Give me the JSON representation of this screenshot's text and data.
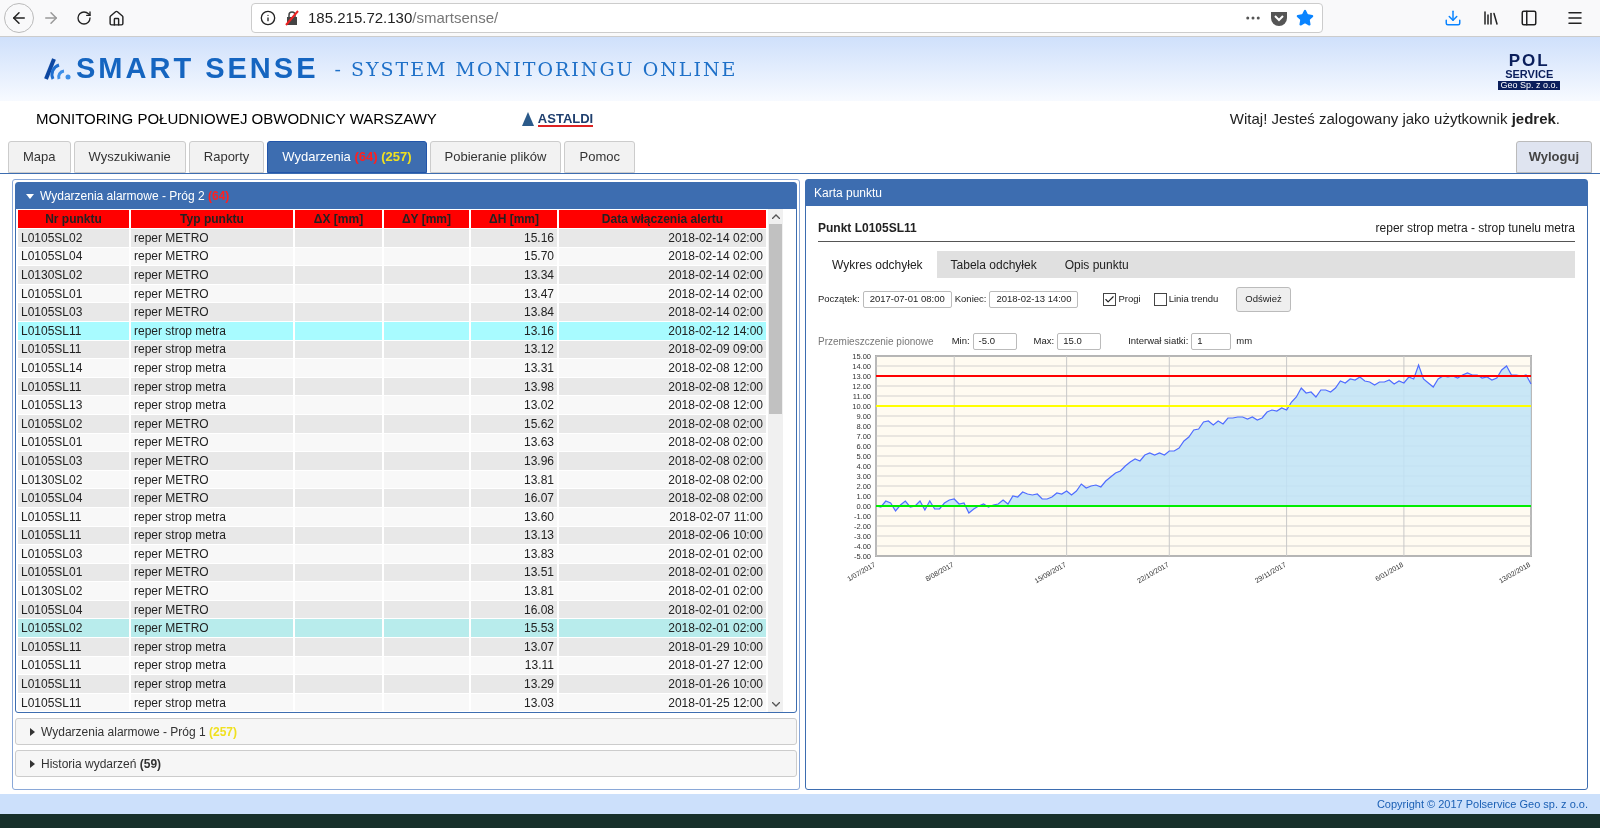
{
  "browser": {
    "url_host": "185.215.72.130",
    "url_path": "/smartsense/"
  },
  "header": {
    "brand": "SMART SENSE",
    "tagline": "- SYSTEM MONITORINGU ONLINE",
    "partner_top": "POL",
    "partner_middle": "SERVICE",
    "partner_bottom": "Geo Sp. z o.o.",
    "project": "MONITORING POŁUDNIOWEJ OBWODNICY WARSZAWY",
    "contractor": "ASTALDI",
    "welcome": "Witaj! Jesteś zalogowany jako użytkownik **jedrek**."
  },
  "tabs": [
    {
      "label": "Mapa",
      "selected": false
    },
    {
      "label": "Wyszukiwanie",
      "selected": false
    },
    {
      "label": "Raporty",
      "selected": false
    },
    {
      "label": "Wydarzenia",
      "alarm_count": "(64)",
      "warning_count": "(257)",
      "selected": true
    },
    {
      "label": "Pobieranie plików",
      "selected": false
    },
    {
      "label": "Pomoc",
      "selected": false
    }
  ],
  "logout": "Wyloguj",
  "events_panel": {
    "sections": [
      {
        "title": "Wydarzenia alarmowe - Próg 2",
        "count": "(64)",
        "color": "#ff2020",
        "expanded": true
      },
      {
        "title": "Wydarzenia alarmowe - Próg 1",
        "count": "(257)",
        "color": "#f0e020",
        "expanded": false
      },
      {
        "title": "Historia wydarzeń",
        "count": "(59)",
        "color": "#333333",
        "expanded": false
      }
    ],
    "table": {
      "columns": [
        "Nr punktu",
        "Typ punktu",
        "ΔX [mm]",
        "ΔY [mm]",
        "ΔH [mm]",
        "Data włączenia alertu"
      ],
      "rows": [
        {
          "point": "L0105SL02",
          "type": "reper METRO",
          "dh": "15.16",
          "date": "2018-02-14 02:00",
          "selected": false,
          "hovered": false
        },
        {
          "point": "L0105SL04",
          "type": "reper METRO",
          "dh": "15.70",
          "date": "2018-02-14 02:00",
          "selected": false,
          "hovered": false
        },
        {
          "point": "L0130SL02",
          "type": "reper METRO",
          "dh": "13.34",
          "date": "2018-02-14 02:00",
          "selected": false,
          "hovered": false
        },
        {
          "point": "L0105SL01",
          "type": "reper METRO",
          "dh": "13.47",
          "date": "2018-02-14 02:00",
          "selected": false,
          "hovered": false
        },
        {
          "point": "L0105SL03",
          "type": "reper METRO",
          "dh": "13.84",
          "date": "2018-02-14 02:00",
          "selected": false,
          "hovered": false
        },
        {
          "point": "L0105SL11",
          "type": "reper strop metra",
          "dh": "13.16",
          "date": "2018-02-12 14:00",
          "selected": true,
          "hovered": false
        },
        {
          "point": "L0105SL11",
          "type": "reper strop metra",
          "dh": "13.12",
          "date": "2018-02-09 09:00",
          "selected": false,
          "hovered": false
        },
        {
          "point": "L0105SL14",
          "type": "reper strop metra",
          "dh": "13.31",
          "date": "2018-02-08 12:00",
          "selected": false,
          "hovered": false
        },
        {
          "point": "L0105SL11",
          "type": "reper strop metra",
          "dh": "13.98",
          "date": "2018-02-08 12:00",
          "selected": false,
          "hovered": false
        },
        {
          "point": "L0105SL13",
          "type": "reper strop metra",
          "dh": "13.02",
          "date": "2018-02-08 12:00",
          "selected": false,
          "hovered": false
        },
        {
          "point": "L0105SL02",
          "type": "reper METRO",
          "dh": "15.62",
          "date": "2018-02-08 02:00",
          "selected": false,
          "hovered": false
        },
        {
          "point": "L0105SL01",
          "type": "reper METRO",
          "dh": "13.63",
          "date": "2018-02-08 02:00",
          "selected": false,
          "hovered": false
        },
        {
          "point": "L0105SL03",
          "type": "reper METRO",
          "dh": "13.96",
          "date": "2018-02-08 02:00",
          "selected": false,
          "hovered": false
        },
        {
          "point": "L0130SL02",
          "type": "reper METRO",
          "dh": "13.81",
          "date": "2018-02-08 02:00",
          "selected": false,
          "hovered": false
        },
        {
          "point": "L0105SL04",
          "type": "reper METRO",
          "dh": "16.07",
          "date": "2018-02-08 02:00",
          "selected": false,
          "hovered": false
        },
        {
          "point": "L0105SL11",
          "type": "reper strop metra",
          "dh": "13.60",
          "date": "2018-02-07 11:00",
          "selected": false,
          "hovered": false
        },
        {
          "point": "L0105SL11",
          "type": "reper strop metra",
          "dh": "13.13",
          "date": "2018-02-06 10:00",
          "selected": false,
          "hovered": false
        },
        {
          "point": "L0105SL03",
          "type": "reper METRO",
          "dh": "13.83",
          "date": "2018-02-01 02:00",
          "selected": false,
          "hovered": false
        },
        {
          "point": "L0105SL01",
          "type": "reper METRO",
          "dh": "13.51",
          "date": "2018-02-01 02:00",
          "selected": false,
          "hovered": false
        },
        {
          "point": "L0130SL02",
          "type": "reper METRO",
          "dh": "13.81",
          "date": "2018-02-01 02:00",
          "selected": false,
          "hovered": false
        },
        {
          "point": "L0105SL04",
          "type": "reper METRO",
          "dh": "16.08",
          "date": "2018-02-01 02:00",
          "selected": false,
          "hovered": false
        },
        {
          "point": "L0105SL02",
          "type": "reper METRO",
          "dh": "15.53",
          "date": "2018-02-01 02:00",
          "selected": false,
          "hovered": true
        },
        {
          "point": "L0105SL11",
          "type": "reper strop metra",
          "dh": "13.07",
          "date": "2018-01-29 10:00",
          "selected": false,
          "hovered": false
        },
        {
          "point": "L0105SL11",
          "type": "reper strop metra",
          "dh": "13.11",
          "date": "2018-01-27 12:00",
          "selected": false,
          "hovered": false
        },
        {
          "point": "L0105SL11",
          "type": "reper strop metra",
          "dh": "13.29",
          "date": "2018-01-26 10:00",
          "selected": false,
          "hovered": false
        },
        {
          "point": "L0105SL11",
          "type": "reper strop metra",
          "dh": "13.03",
          "date": "2018-01-25 12:00",
          "selected": false,
          "hovered": false
        }
      ]
    }
  },
  "point_card": {
    "title": "Karta punktu",
    "point": "Punkt L0105SL11",
    "description": "reper strop metra - strop tunelu metra",
    "tabs": [
      {
        "label": "Wykres odchyłek",
        "selected": true
      },
      {
        "label": "Tabela odchyłek",
        "selected": false
      },
      {
        "label": "Opis punktu",
        "selected": false
      }
    ],
    "start_label": "Początek:",
    "start": "2017-07-01 08:00",
    "end_label": "Koniec:",
    "end": "2018-02-13 14:00",
    "options": [
      {
        "label": "Progi",
        "checked": true
      },
      {
        "label": "Linia trendu",
        "checked": false
      }
    ],
    "refresh": "Odśwież",
    "chart_title": "Przemieszczenie pionowe",
    "min_label": "Min:",
    "min": "-5.0",
    "max_label": "Max:",
    "max": "15.0",
    "grid_label": "Interwał siatki:",
    "grid": "1",
    "grid_unit": "mm",
    "chart_data": {
      "type": "area",
      "grid": true,
      "ylim": [
        -5,
        15
      ],
      "categories": [
        "1/07/2017",
        null,
        null,
        null,
        null,
        null,
        null,
        null,
        null,
        null,
        null,
        null,
        null,
        null,
        null,
        null,
        "8/08/2017",
        null,
        null,
        null,
        null,
        null,
        null,
        null,
        null,
        null,
        null,
        null,
        null,
        null,
        null,
        null,
        null,
        null,
        null,
        null,
        null,
        null,
        null,
        "15/09/2017",
        null,
        null,
        null,
        null,
        null,
        null,
        null,
        null,
        null,
        null,
        null,
        null,
        null,
        null,
        null,
        null,
        null,
        null,
        null,
        null,
        "22/10/2017",
        null,
        null,
        null,
        null,
        null,
        null,
        null,
        null,
        null,
        null,
        null,
        null,
        null,
        null,
        null,
        null,
        null,
        null,
        null,
        null,
        null,
        null,
        null,
        "29/11/2017",
        null,
        null,
        null,
        null,
        null,
        null,
        null,
        null,
        null,
        null,
        null,
        null,
        null,
        null,
        null,
        null,
        null,
        null,
        null,
        null,
        null,
        null,
        null,
        "6/01/2018",
        null,
        null,
        null,
        null,
        null,
        null,
        null,
        null,
        null,
        null,
        null,
        null,
        null,
        null,
        null,
        null,
        null,
        null,
        null,
        null,
        null,
        null,
        null,
        null,
        null,
        "13/02/2018"
      ],
      "yticks": [
        {
          "value": -5,
          "label": "-5.00"
        },
        {
          "value": -4,
          "label": "-4.00"
        },
        {
          "value": -3,
          "label": "-3.00"
        },
        {
          "value": -2,
          "label": "-2.00"
        },
        {
          "value": -1,
          "label": "-1.00"
        },
        {
          "value": 0,
          "label": "0.00"
        },
        {
          "value": 1,
          "label": "1.00"
        },
        {
          "value": 2,
          "label": "2.00"
        },
        {
          "value": 3,
          "label": "3.00"
        },
        {
          "value": 4,
          "label": "4.00"
        },
        {
          "value": 5,
          "label": "5.00"
        },
        {
          "value": 6,
          "label": "6.00"
        },
        {
          "value": 7,
          "label": "7.00"
        },
        {
          "value": 8,
          "label": "8.00"
        },
        {
          "value": 9,
          "label": "9.00"
        },
        {
          "value": 10,
          "label": "10.00"
        },
        {
          "value": 11,
          "label": "11.00"
        },
        {
          "value": 12,
          "label": "12.00"
        },
        {
          "value": 13,
          "label": "13.00"
        },
        {
          "value": 14,
          "label": "14.00"
        },
        {
          "value": 15,
          "label": "15.00"
        }
      ],
      "series": [
        {
          "color": "#4f6cff",
          "values": [
            0,
            -0.1,
            0.5,
            0.3,
            -0.5,
            0.1,
            0.5,
            -0.1,
            0,
            0.5,
            -0.4,
            0.5,
            -0.3,
            -0.3,
            0.3,
            0.6,
            0.7,
            0.2,
            0.3,
            -0.7,
            -0.3,
            0,
            0.2,
            -0.1,
            0.1,
            0.2,
            0.6,
            0.2,
            1.0,
            0.9,
            1.4,
            1.2,
            1.1,
            1.2,
            0.7,
            0.7,
            0.9,
            1.3,
            1.2,
            1.5,
            1.1,
            1.5,
            2.2,
            1.8,
            2.0,
            2.1,
            1.9,
            2.5,
            2.9,
            3.3,
            3.5,
            4.0,
            4.4,
            4.7,
            4.5,
            5.1,
            5.3,
            5.1,
            5.3,
            5.1,
            5.5,
            5.5,
            5.8,
            6.5,
            6.9,
            7.6,
            7.7,
            8.4,
            8.5,
            8.1,
            8.5,
            8.2,
            8.8,
            8.8,
            8.9,
            8.9,
            8.7,
            8.9,
            8.6,
            8.8,
            9.4,
            9.6,
            9.5,
            9.8,
            9.6,
            10.4,
            10.9,
            11.8,
            11.3,
            11.4,
            10.9,
            11.6,
            11.6,
            11.4,
            11.8,
            12.5,
            12.3,
            12.7,
            12.6,
            12.9,
            12.5,
            12.4,
            12.1,
            12.4,
            12.4,
            12.6,
            12.2,
            12.5,
            12.3,
            12.9,
            12.7,
            14.1,
            12.7,
            12.3,
            11.9,
            12.7,
            13.0,
            12.9,
            13.0,
            12.8,
            13.1,
            13.3,
            13.1,
            13.1,
            12.8,
            12.9,
            12.6,
            12.8,
            13.6,
            14.0,
            13.1,
            13.1,
            13.0,
            13.1,
            12.2
          ]
        },
        {
          "color": "#ff0000",
          "type": "line",
          "values": [
            13,
            13,
            13,
            13,
            13,
            13,
            13,
            13,
            13,
            13,
            13,
            13,
            13,
            13,
            13,
            13,
            13,
            13,
            13,
            13,
            13,
            13,
            13,
            13,
            13,
            13,
            13,
            13,
            13,
            13,
            13,
            13,
            13,
            13,
            13,
            13,
            13,
            13,
            13,
            13,
            13,
            13,
            13,
            13,
            13,
            13,
            13,
            13,
            13,
            13,
            13,
            13,
            13,
            13,
            13,
            13,
            13,
            13,
            13,
            13,
            13,
            13,
            13,
            13,
            13,
            13,
            13,
            13,
            13,
            13,
            13,
            13,
            13,
            13,
            13,
            13,
            13,
            13,
            13,
            13,
            13,
            13,
            13,
            13,
            13,
            13,
            13,
            13,
            13,
            13,
            13,
            13,
            13,
            13,
            13,
            13,
            13,
            13,
            13,
            13,
            13,
            13,
            13,
            13,
            13,
            13,
            13,
            13,
            13,
            13,
            13,
            13,
            13,
            13,
            13,
            13,
            13,
            13,
            13,
            13,
            13,
            13,
            13,
            13,
            13,
            13,
            13,
            13,
            13,
            13,
            13,
            13,
            13,
            13,
            13
          ]
        },
        {
          "color": "#ffff00",
          "type": "line",
          "values": [
            10,
            10,
            10,
            10,
            10,
            10,
            10,
            10,
            10,
            10,
            10,
            10,
            10,
            10,
            10,
            10,
            10,
            10,
            10,
            10,
            10,
            10,
            10,
            10,
            10,
            10,
            10,
            10,
            10,
            10,
            10,
            10,
            10,
            10,
            10,
            10,
            10,
            10,
            10,
            10,
            10,
            10,
            10,
            10,
            10,
            10,
            10,
            10,
            10,
            10,
            10,
            10,
            10,
            10,
            10,
            10,
            10,
            10,
            10,
            10,
            10,
            10,
            10,
            10,
            10,
            10,
            10,
            10,
            10,
            10,
            10,
            10,
            10,
            10,
            10,
            10,
            10,
            10,
            10,
            10,
            10,
            10,
            10,
            10,
            10,
            10,
            10,
            10,
            10,
            10,
            10,
            10,
            10,
            10,
            10,
            10,
            10,
            10,
            10,
            10,
            10,
            10,
            10,
            10,
            10,
            10,
            10,
            10,
            10,
            10,
            10,
            10,
            10,
            10,
            10,
            10,
            10,
            10,
            10,
            10,
            10,
            10,
            10,
            10,
            10,
            10,
            10,
            10,
            10,
            10,
            10,
            10,
            10,
            10,
            10
          ]
        },
        {
          "color": "#00ee00",
          "type": "line",
          "values": [
            0,
            0,
            0,
            0,
            0,
            0,
            0,
            0,
            0,
            0,
            0,
            0,
            0,
            0,
            0,
            0,
            0,
            0,
            0,
            0,
            0,
            0,
            0,
            0,
            0,
            0,
            0,
            0,
            0,
            0,
            0,
            0,
            0,
            0,
            0,
            0,
            0,
            0,
            0,
            0,
            0,
            0,
            0,
            0,
            0,
            0,
            0,
            0,
            0,
            0,
            0,
            0,
            0,
            0,
            0,
            0,
            0,
            0,
            0,
            0,
            0,
            0,
            0,
            0,
            0,
            0,
            0,
            0,
            0,
            0,
            0,
            0,
            0,
            0,
            0,
            0,
            0,
            0,
            0,
            0,
            0,
            0,
            0,
            0,
            0,
            0,
            0,
            0,
            0,
            0,
            0,
            0,
            0,
            0,
            0,
            0,
            0,
            0,
            0,
            0,
            0,
            0,
            0,
            0,
            0,
            0,
            0,
            0,
            0,
            0,
            0,
            0,
            0,
            0,
            0,
            0,
            0,
            0,
            0,
            0,
            0,
            0,
            0,
            0,
            0,
            0,
            0,
            0,
            0,
            0,
            0,
            0,
            0,
            0,
            0
          ]
        }
      ]
    }
  },
  "status_bar": {
    "copyright": "Copyright © 2017 Polservice Geo sp. z o.o."
  }
}
